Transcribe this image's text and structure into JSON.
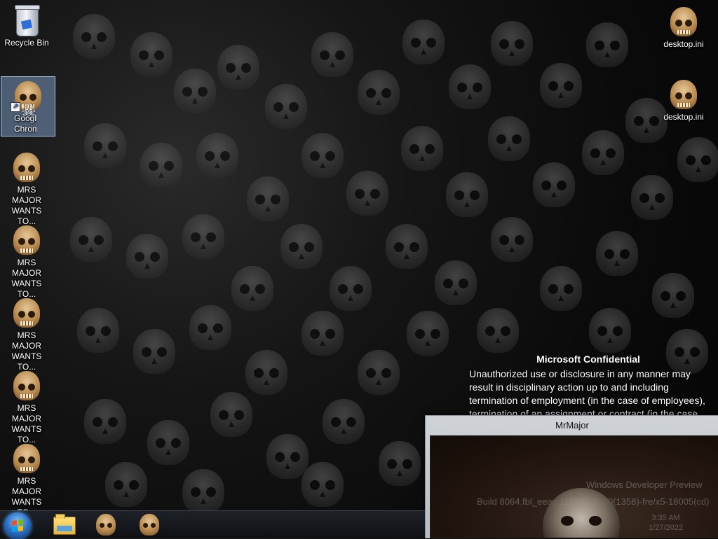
{
  "desktop": {
    "icons": [
      {
        "label": "Recycle Bin",
        "icon": "recycle-bin-icon"
      },
      {
        "label": "Google Chrome",
        "icon": "skull-icon",
        "selected": true
      },
      {
        "label": "MRS MAJOR WANTS TO...",
        "icon": "skull-icon"
      },
      {
        "label": "MRS MAJOR WANTS TO...",
        "icon": "skull-icon"
      },
      {
        "label": "MRS MAJOR WANTS TO...",
        "icon": "skull-icon"
      },
      {
        "label": "MRS MAJOR WANTS TO...",
        "icon": "skull-icon"
      },
      {
        "label": "MRS MAJOR WANTS TO...",
        "icon": "skull-icon"
      }
    ],
    "right_icons": [
      {
        "label": "desktop.ini",
        "icon": "skull-icon"
      },
      {
        "label": "desktop.ini",
        "icon": "skull-icon"
      }
    ]
  },
  "notice": {
    "title": "Microsoft Confidential",
    "body": "Unauthorized use or disclosure in any manner may result in disciplinary action up to and including termination of employment (in the case of employees), termination of an assignment or contract (in the case of contingent staff), and potential civil and criminal liability."
  },
  "window": {
    "title": "MrMajor",
    "faint_line1": "Windows Developer Preview",
    "faint_line2": "Build 8064.fbl_eeap.110803-1600(1358)-fre/x5-18005(cd)",
    "faint_time": "3:35 AM",
    "faint_date": "1/27/2022"
  },
  "taskbar": {
    "items": [
      {
        "icon": "windows-start-icon"
      },
      {
        "icon": "file-explorer-icon"
      },
      {
        "icon": "skull-icon"
      },
      {
        "icon": "skull-icon"
      }
    ]
  }
}
